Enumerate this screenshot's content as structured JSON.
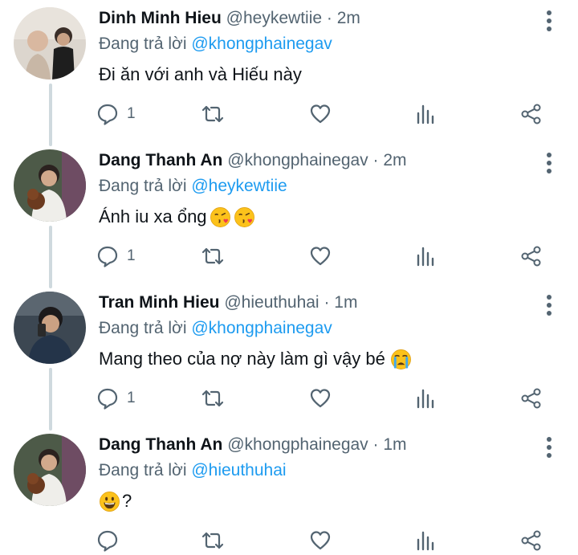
{
  "reply_prefix": "Đang trả lời",
  "tweets": [
    {
      "name": "Dinh Minh Hieu",
      "handle": "@heykewtiie",
      "separator": "·",
      "time": "2m",
      "reply_to": "@khongphainegav",
      "text": "Đi ăn với anh và Hiếu này",
      "emojis": [],
      "reply_count": "1"
    },
    {
      "name": "Dang Thanh An",
      "handle": "@khongphainegav",
      "separator": "·",
      "time": "2m",
      "reply_to": "@heykewtiie",
      "text": "Ánh iu xa ổng",
      "emojis": [
        "kissing-heart",
        "kissing-heart"
      ],
      "reply_count": "1"
    },
    {
      "name": "Tran Minh Hieu",
      "handle": "@hieuthuhai",
      "separator": "·",
      "time": "1m",
      "reply_to": "@khongphainegav",
      "text": "Mang theo của nợ này làm gì vậy bé",
      "emojis": [
        "crying"
      ],
      "reply_count": "1"
    },
    {
      "name": "Dang Thanh An",
      "handle": "@khongphainegav",
      "separator": "·",
      "time": "1m",
      "reply_to": "@hieuthuhai",
      "text": "?",
      "emojis": [
        "grinning"
      ],
      "reply_count": ""
    }
  ],
  "colors": {
    "text": "#0f1419",
    "secondary": "#536471",
    "link": "#1d9bf0",
    "thread_line": "#cfd9de"
  }
}
